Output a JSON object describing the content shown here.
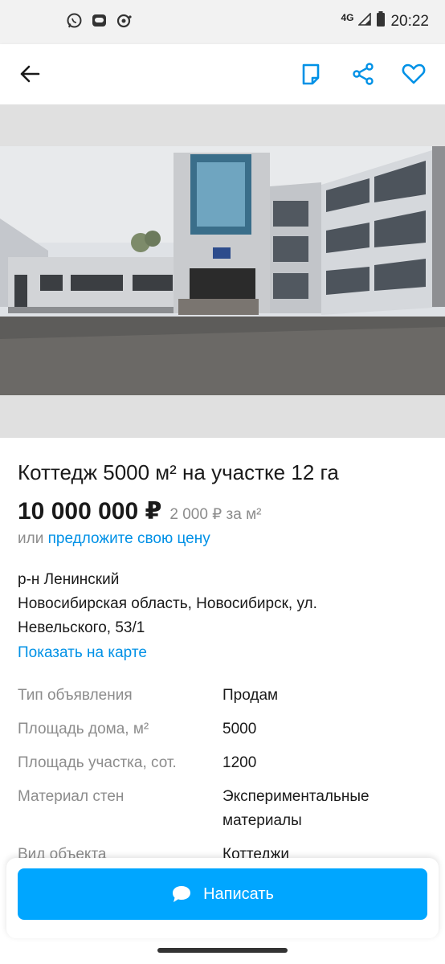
{
  "status_bar": {
    "network": "4G",
    "time": "20:22",
    "icons": [
      "whatsapp-icon",
      "messenger-icon",
      "clip-icon",
      "signal-icon",
      "battery-icon"
    ]
  },
  "app_bar": {
    "icons": [
      "back-arrow-icon",
      "note-icon",
      "share-icon",
      "favorite-heart-icon"
    ],
    "accent": "#0091e6"
  },
  "gallery": {
    "photo_description": "building-photo"
  },
  "listing": {
    "title": "Коттедж 5000 м² на участке 12 га",
    "price": "10 000 000 ₽",
    "price_per_m": "2 000 ₽ за м²",
    "offer_prefix": "или",
    "offer_link": "предложите свою цену",
    "address_line1": "р-н Ленинский",
    "address_line2": "Новосибирская область, Новосибирск, ул. Невельского, 53/1",
    "map_link": "Показать на карте"
  },
  "params": [
    {
      "key": "Тип объявления",
      "value": "Продам"
    },
    {
      "key": "Площадь дома, м²",
      "value": "5000"
    },
    {
      "key": "Площадь участка, сот.",
      "value": "1200"
    },
    {
      "key": "Материал стен",
      "value": "Экспериментальные материалы"
    },
    {
      "key": "Вид объекта",
      "value": "Коттеджи"
    }
  ],
  "bottom": {
    "write_label": "Написать",
    "button_color": "#00a6ff"
  }
}
